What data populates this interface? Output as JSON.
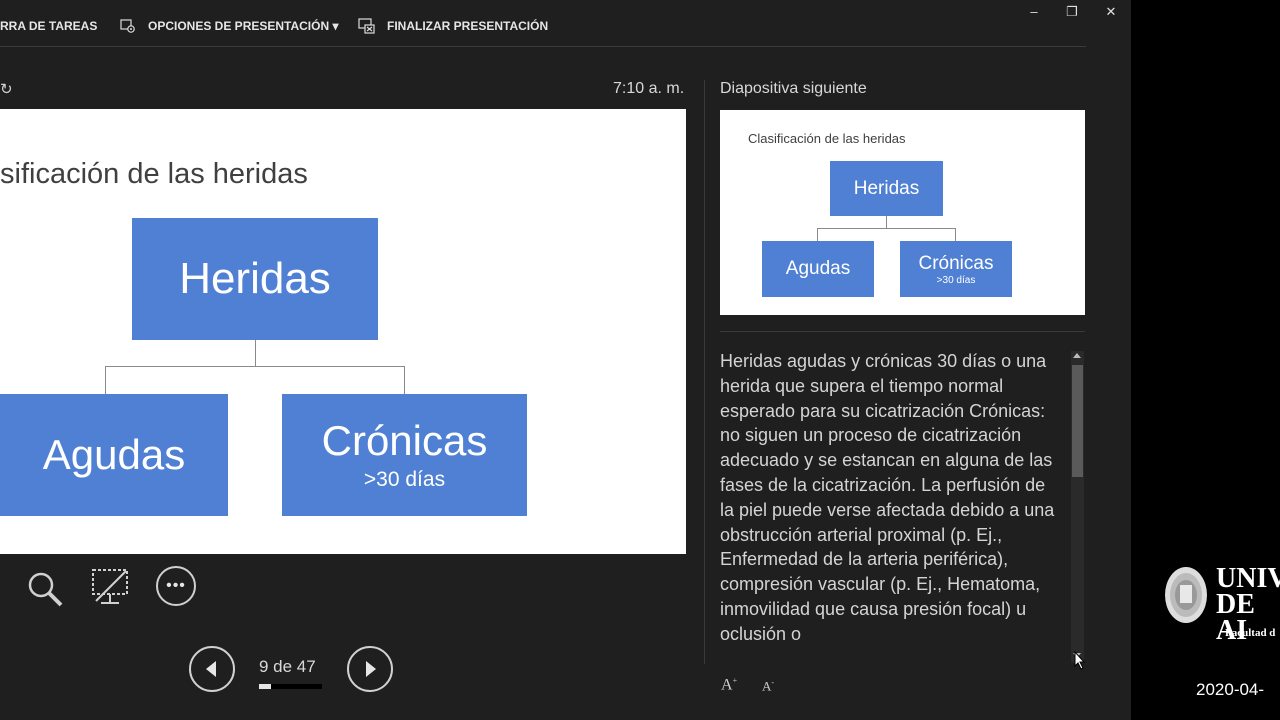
{
  "toolbar": {
    "taskbar_label": "RRA DE TAREAS",
    "presentation_options_label": "OPCIONES DE PRESENTACIÓN ▾",
    "end_presentation_label": "FINALIZAR PRESENTACIÓN"
  },
  "window_controls": {
    "minimize": "–",
    "restore": "❐",
    "close": "✕"
  },
  "presenter": {
    "timer_icon": "reset-timer-icon",
    "clock": "7:10 a. m."
  },
  "current_slide": {
    "title": "sificación de las heridas",
    "root": "Heridas",
    "left_child": "Agudas",
    "right_child": "Crónicas",
    "right_child_sub": ">30 días"
  },
  "next_slide": {
    "header": "Diapositiva siguiente",
    "title": "Clasificación de las heridas",
    "root": "Heridas",
    "left_child": "Agudas",
    "right_child": "Crónicas",
    "right_child_sub": ">30 días"
  },
  "notes": {
    "text": "Heridas agudas y crónicas 30 días o una herida que supera el tiempo normal esperado para su cicatrización  Crónicas: no siguen un proceso de cicatrización adecuado y se estancan en alguna de las fases de la cicatrización. La perfusión de la piel puede verse afectada debido a una obstrucción arterial proximal (p. Ej., Enfermedad de la arteria periférica), compresión vascular (p. Ej., Hematoma, inmovilidad que causa presión focal) u oclusión o"
  },
  "font_controls": {
    "increase": "A",
    "decrease": "A"
  },
  "navigation": {
    "counter": "9 de 47",
    "progress": 0.19
  },
  "watermark": {
    "university_line1": "UNIV",
    "university_line2": "DE AI",
    "faculty": "Facultad d",
    "date": "2020-04-"
  },
  "colors": {
    "box_blue": "#4f80d3",
    "background": "#1f1f1f"
  }
}
